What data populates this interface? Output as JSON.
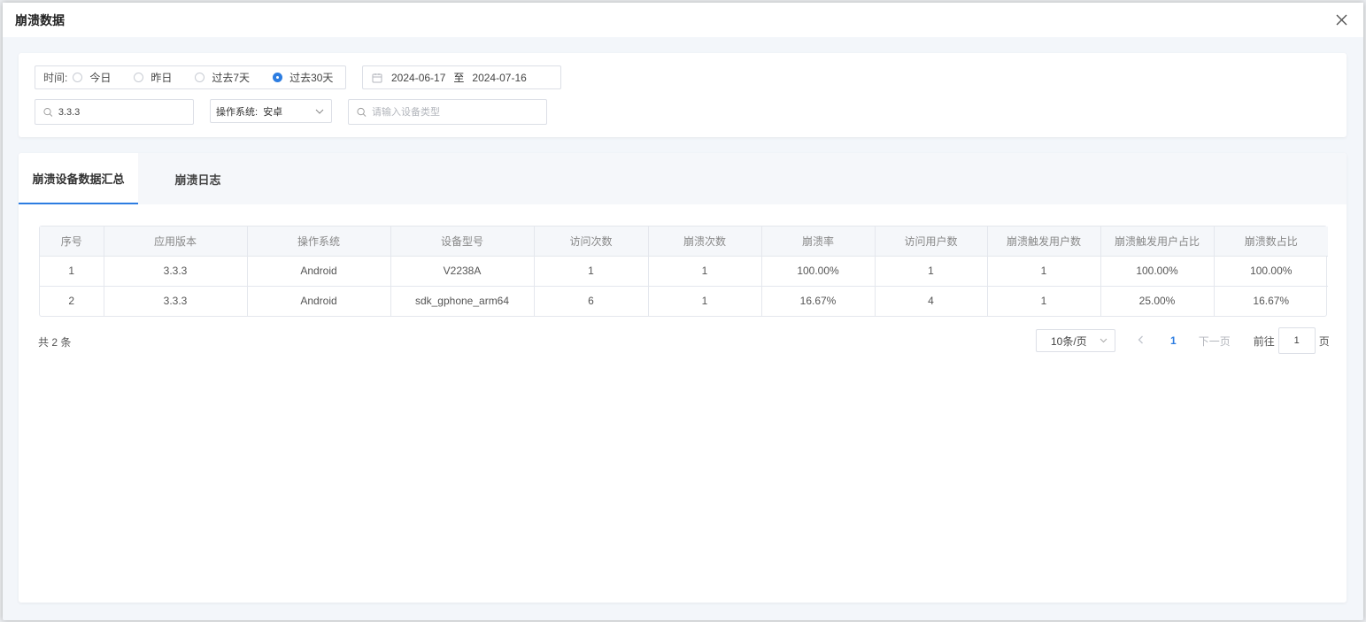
{
  "modal": {
    "title": "崩溃数据"
  },
  "filters": {
    "time_label": "时间:",
    "time_options": [
      "今日",
      "昨日",
      "过去7天",
      "过去30天"
    ],
    "time_selected": "过去30天",
    "date_start": "2024-06-17",
    "date_sep": "至",
    "date_end": "2024-07-16",
    "version_value": "3.3.3",
    "os_label": "操作系统:",
    "os_value": "安卓",
    "device_placeholder": "请输入设备类型"
  },
  "tabs": [
    "崩溃设备数据汇总",
    "崩溃日志"
  ],
  "table": {
    "headers": [
      "序号",
      "应用版本",
      "操作系统",
      "设备型号",
      "访问次数",
      "崩溃次数",
      "崩溃率",
      "访问用户数",
      "崩溃触发用户数",
      "崩溃触发用户占比",
      "崩溃数占比"
    ],
    "rows": [
      [
        "1",
        "3.3.3",
        "Android",
        "V2238A",
        "1",
        "1",
        "100.00%",
        "1",
        "1",
        "100.00%",
        "100.00%"
      ],
      [
        "2",
        "3.3.3",
        "Android",
        "sdk_gphone_arm64",
        "6",
        "1",
        "16.67%",
        "4",
        "1",
        "25.00%",
        "16.67%"
      ]
    ]
  },
  "pagination": {
    "total": "共 2 条",
    "page_size": "10条/页",
    "current_page": "1",
    "next": "下一页",
    "goto_label": "前往",
    "goto_value": "1",
    "goto_unit": "页"
  },
  "colors": {
    "accent": "#2d7de1"
  }
}
